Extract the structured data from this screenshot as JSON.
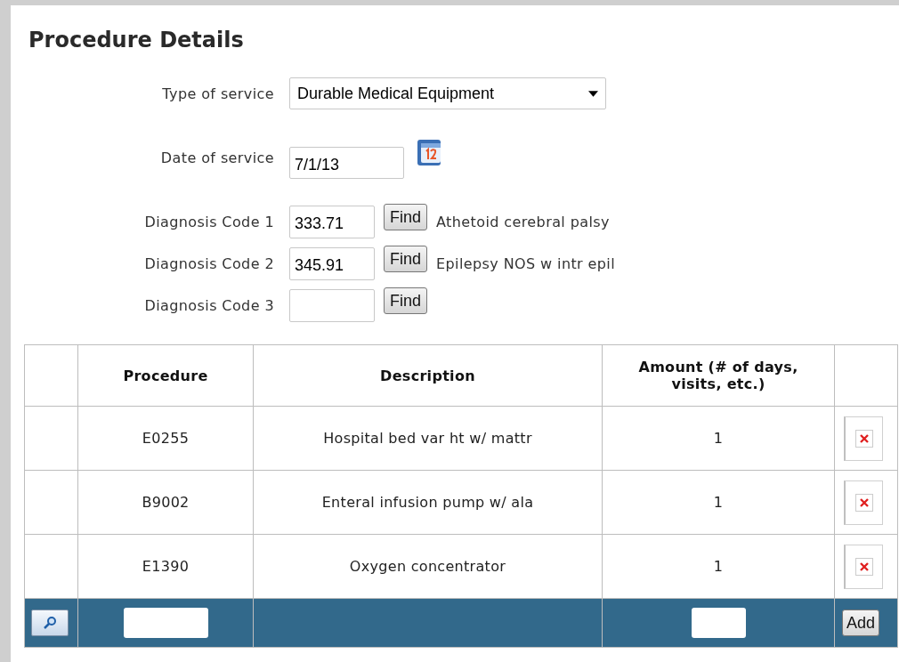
{
  "title": "Procedure Details",
  "type_of_service": {
    "label": "Type of service",
    "value": "Durable Medical Equipment"
  },
  "date_of_service": {
    "label": "Date of service",
    "value": "7/1/13"
  },
  "diagnosis_codes": [
    {
      "label": "Diagnosis Code 1",
      "value": "333.71",
      "button": "Find",
      "description": "Athetoid cerebral palsy"
    },
    {
      "label": "Diagnosis Code 2",
      "value": "345.91",
      "button": "Find",
      "description": "Epilepsy NOS w intr epil"
    },
    {
      "label": "Diagnosis Code 3",
      "button": "Find"
    }
  ],
  "table": {
    "columns": [
      "Procedure",
      "Description",
      "Amount (# of days, visits, etc.)"
    ],
    "rows": [
      {
        "procedure": "E0255",
        "description": "Hospital bed var ht w/ mattr",
        "amount": "1"
      },
      {
        "procedure": "B9002",
        "description": "Enteral infusion pump w/ ala",
        "amount": "1"
      },
      {
        "procedure": "E1390",
        "description": "Oxygen concentrator",
        "amount": "1"
      }
    ],
    "add_button": "Add"
  }
}
